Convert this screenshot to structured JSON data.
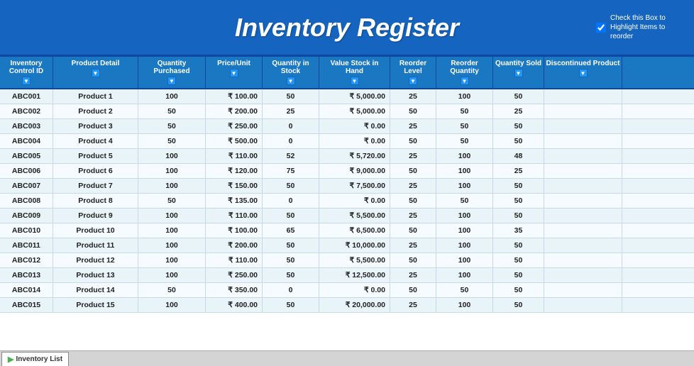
{
  "header": {
    "title": "Inventory Register",
    "checkbox_label": "Check this Box to Highlight Items to reorder"
  },
  "columns": [
    {
      "id": "col-id",
      "label": "Inventory Control ID",
      "class": "col-id"
    },
    {
      "id": "col-product",
      "label": "Product Detail",
      "class": "col-product"
    },
    {
      "id": "col-qty-purchased",
      "label": "Quantity Purchased",
      "class": "col-qty-purchased"
    },
    {
      "id": "col-price",
      "label": "Price/Unit",
      "class": "col-price"
    },
    {
      "id": "col-qty-stock",
      "label": "Quantity in Stock",
      "class": "col-qty-stock"
    },
    {
      "id": "col-value-stock",
      "label": "Value Stock in Hand",
      "class": "col-value-stock"
    },
    {
      "id": "col-reorder-level",
      "label": "Reorder Level",
      "class": "col-reorder-level"
    },
    {
      "id": "col-reorder-qty",
      "label": "Reorder Quantity",
      "class": "col-reorder-qty"
    },
    {
      "id": "col-qty-sold",
      "label": "Quantity Sold",
      "class": "col-qty-sold"
    },
    {
      "id": "col-discontinued",
      "label": "Discontinued Product",
      "class": "col-discontinued"
    }
  ],
  "rows": [
    {
      "id": "ABC001",
      "product": "Product 1",
      "qty_purchased": "100",
      "price": "₹ 100.00",
      "qty_stock": "50",
      "value_stock": "₹ 5,000.00",
      "reorder_level": "25",
      "reorder_qty": "100",
      "qty_sold": "50",
      "discontinued": ""
    },
    {
      "id": "ABC002",
      "product": "Product 2",
      "qty_purchased": "50",
      "price": "₹ 200.00",
      "qty_stock": "25",
      "value_stock": "₹ 5,000.00",
      "reorder_level": "50",
      "reorder_qty": "50",
      "qty_sold": "25",
      "discontinued": ""
    },
    {
      "id": "ABC003",
      "product": "Product 3",
      "qty_purchased": "50",
      "price": "₹ 250.00",
      "qty_stock": "0",
      "value_stock": "₹ 0.00",
      "reorder_level": "25",
      "reorder_qty": "50",
      "qty_sold": "50",
      "discontinued": ""
    },
    {
      "id": "ABC004",
      "product": "Product 4",
      "qty_purchased": "50",
      "price": "₹ 500.00",
      "qty_stock": "0",
      "value_stock": "₹ 0.00",
      "reorder_level": "50",
      "reorder_qty": "50",
      "qty_sold": "50",
      "discontinued": ""
    },
    {
      "id": "ABC005",
      "product": "Product 5",
      "qty_purchased": "100",
      "price": "₹ 110.00",
      "qty_stock": "52",
      "value_stock": "₹ 5,720.00",
      "reorder_level": "25",
      "reorder_qty": "100",
      "qty_sold": "48",
      "discontinued": ""
    },
    {
      "id": "ABC006",
      "product": "Product 6",
      "qty_purchased": "100",
      "price": "₹ 120.00",
      "qty_stock": "75",
      "value_stock": "₹ 9,000.00",
      "reorder_level": "50",
      "reorder_qty": "100",
      "qty_sold": "25",
      "discontinued": ""
    },
    {
      "id": "ABC007",
      "product": "Product 7",
      "qty_purchased": "100",
      "price": "₹ 150.00",
      "qty_stock": "50",
      "value_stock": "₹ 7,500.00",
      "reorder_level": "25",
      "reorder_qty": "100",
      "qty_sold": "50",
      "discontinued": ""
    },
    {
      "id": "ABC008",
      "product": "Product 8",
      "qty_purchased": "50",
      "price": "₹ 135.00",
      "qty_stock": "0",
      "value_stock": "₹ 0.00",
      "reorder_level": "50",
      "reorder_qty": "50",
      "qty_sold": "50",
      "discontinued": ""
    },
    {
      "id": "ABC009",
      "product": "Product 9",
      "qty_purchased": "100",
      "price": "₹ 110.00",
      "qty_stock": "50",
      "value_stock": "₹ 5,500.00",
      "reorder_level": "25",
      "reorder_qty": "100",
      "qty_sold": "50",
      "discontinued": ""
    },
    {
      "id": "ABC010",
      "product": "Product 10",
      "qty_purchased": "100",
      "price": "₹ 100.00",
      "qty_stock": "65",
      "value_stock": "₹ 6,500.00",
      "reorder_level": "50",
      "reorder_qty": "100",
      "qty_sold": "35",
      "discontinued": ""
    },
    {
      "id": "ABC011",
      "product": "Product 11",
      "qty_purchased": "100",
      "price": "₹ 200.00",
      "qty_stock": "50",
      "value_stock": "₹ 10,000.00",
      "reorder_level": "25",
      "reorder_qty": "100",
      "qty_sold": "50",
      "discontinued": ""
    },
    {
      "id": "ABC012",
      "product": "Product 12",
      "qty_purchased": "100",
      "price": "₹ 110.00",
      "qty_stock": "50",
      "value_stock": "₹ 5,500.00",
      "reorder_level": "50",
      "reorder_qty": "100",
      "qty_sold": "50",
      "discontinued": ""
    },
    {
      "id": "ABC013",
      "product": "Product 13",
      "qty_purchased": "100",
      "price": "₹ 250.00",
      "qty_stock": "50",
      "value_stock": "₹ 12,500.00",
      "reorder_level": "25",
      "reorder_qty": "100",
      "qty_sold": "50",
      "discontinued": ""
    },
    {
      "id": "ABC014",
      "product": "Product 14",
      "qty_purchased": "50",
      "price": "₹ 350.00",
      "qty_stock": "0",
      "value_stock": "₹ 0.00",
      "reorder_level": "50",
      "reorder_qty": "50",
      "qty_sold": "50",
      "discontinued": ""
    },
    {
      "id": "ABC015",
      "product": "Product 15",
      "qty_purchased": "100",
      "price": "₹ 400.00",
      "qty_stock": "50",
      "value_stock": "₹ 20,000.00",
      "reorder_level": "25",
      "reorder_qty": "100",
      "qty_sold": "50",
      "discontinued": ""
    }
  ],
  "tab": {
    "label": "Inventory List"
  }
}
